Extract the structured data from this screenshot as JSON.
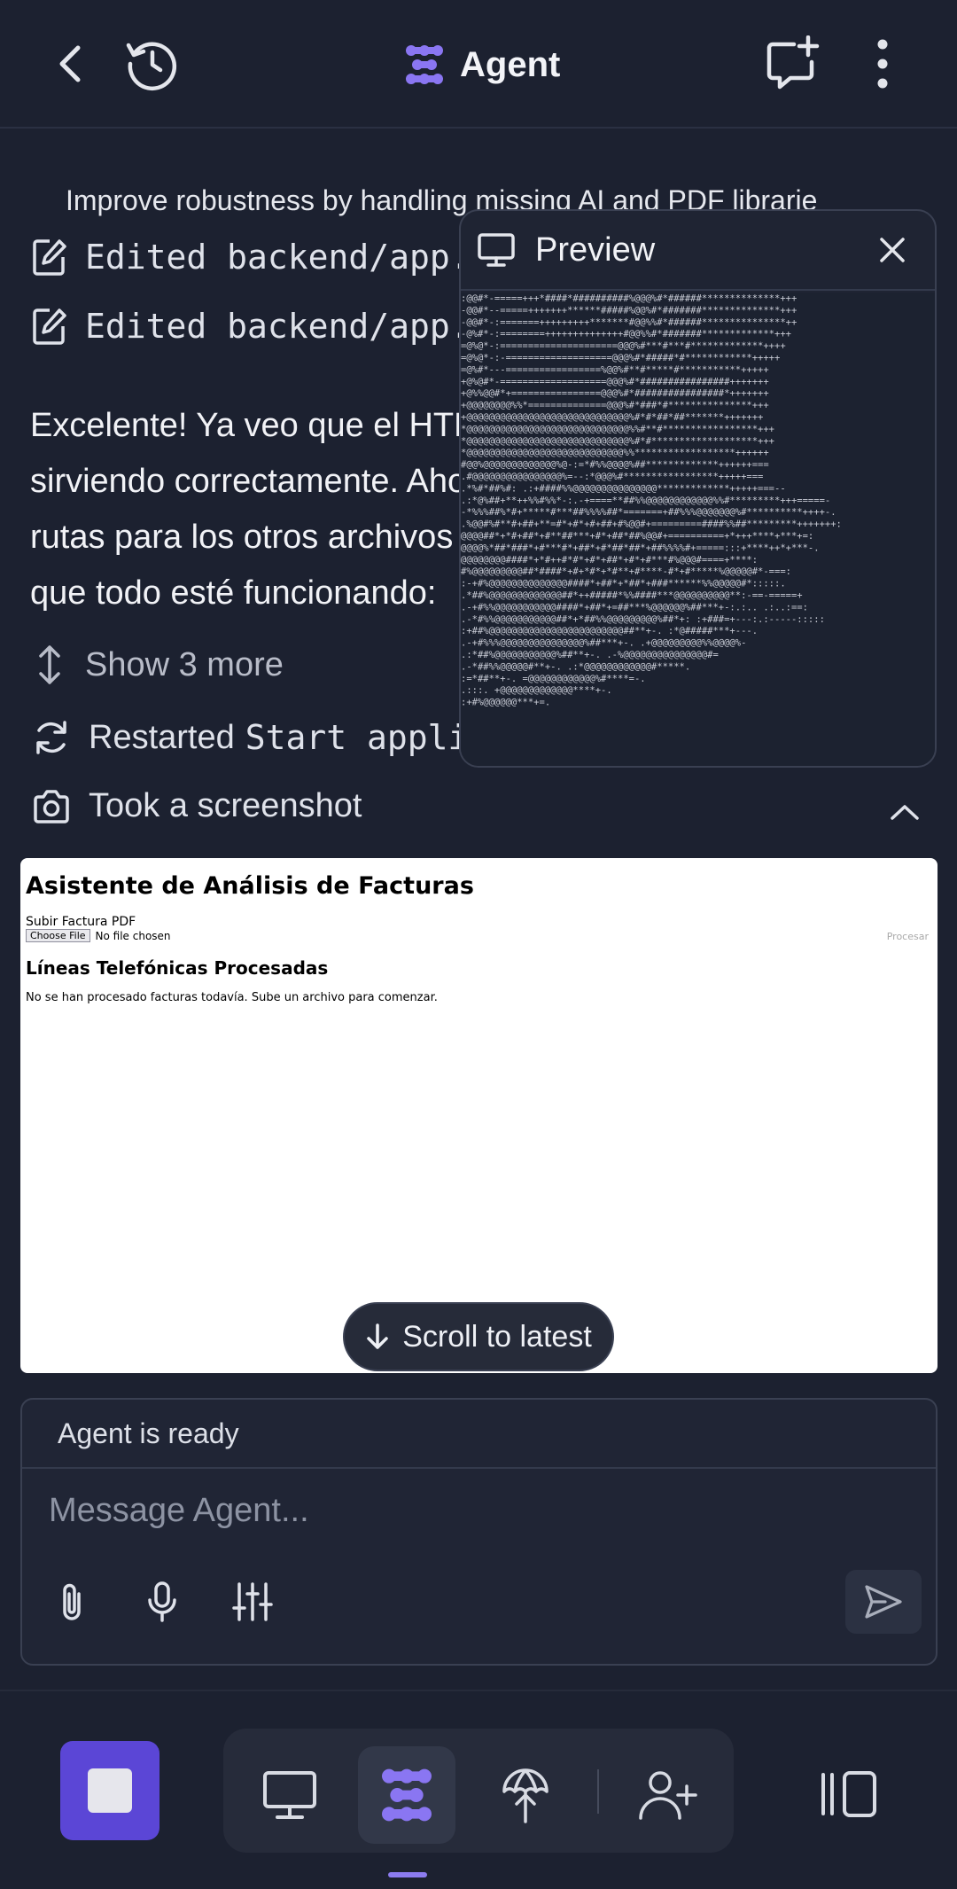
{
  "header": {
    "title": "Agent"
  },
  "chat": {
    "truncated_line": "Improve robustness by handling missing AI and PDF librarie",
    "edits": [
      {
        "label": "Edited backend/app.py"
      },
      {
        "label": "Edited backend/app.py"
      }
    ],
    "message_lines": [
      "Excelente! Ya veo que el HTML se está",
      "sirviendo correctamente. Ahora voy a ajustar las",
      "rutas para los otros archivos estáticos para",
      "que todo esté funcionando:"
    ],
    "show_more": "Show 3 more",
    "restarted_prefix": "Restarted",
    "restarted_code": "Start application",
    "took_screenshot": "Took a screenshot",
    "scroll_to_latest": "Scroll to latest"
  },
  "screenshot": {
    "title": "Asistente de Análisis de Facturas",
    "upload_label": "Subir Factura PDF",
    "choose_file": "Choose File",
    "no_file": "No file chosen",
    "process_button": "Procesar",
    "section_title": "Líneas Telefónicas Procesadas",
    "empty_message": "No se han procesado facturas todavía. Sube un archivo para comenzar."
  },
  "preview": {
    "title": "Preview",
    "ascii_lines": [
      "                     :@@#*-=====+++*####*##########%@@@%#*######**************+++",
      "                     -@@#*--=====+++++++******#####%@@%#*#######**************+++",
      "                     -@@#*-:=======+++++++++*******#@@%%#*######***************++",
      "                     -@%#*-:========++++++++++++++#@@%%#*#######*************+++",
      "                     =@%@*-:=====================@@@%#***#***#*************++++",
      "                     =@%@*-:-===================@@@%#*#####*#************+++++",
      "                     =@%#*---=================%@@%#**#*****#***********+++++",
      "                     +@%@#*-===================@@@%#*################+++++++",
      "                     +@%%@@#*+================@@@%#*################*+++++++",
      "                     +@@@@@@@@%%*==============@@@%#*###*#***************+++",
      "                     +@@@@@@@@@@@@@@@@@@@@@@@@@@@@@%#*#*##*##*******+++++++",
      "                     *@@@@@@@@@@@@@@@@@@@@@@@@@@@@@%%#**#*****************+++",
      "                     *@@@@@@@@@@@@@@@@@@@@@@@@@@@@@%#*#*******************+++",
      "                     *@@@@@@@@@@@@@@@@@@@@@@@@@@@@%%******************++++++",
      "                     #@@%@@@@@@@@@@@@@%@-:=*#%%@@@@%##*************++++++===",
      "                     .#@@@@@@@@@@@@@@@@%=--:*@@@%#*****************+++++===",
      "           .*%#*##%#:    .:+####%%@@@@@@@@@@@@@@@*************+++++===--",
      "       .:*@%##+**++%%#%%*-:.-+====**##%%@@@@@@@@@@@@%%#*********+++=====-",
      "     -*%%%##%*#+*****#***##%%%%##*=======+##%%%@@@@@@@%#**********++++-.",
      "  .%@@#%#**#+##+**=#*+#*+#+##+#%@@#+=========####%%##*********+++++++:",
      " @@@@##*+*#+##*+#**##***+#*+##*##%@@#+==========+*+++****+***+=:",
      " @@@@%*##*###*+#***#*+##*+#*##*##*+##%%%%#+=====:::+****++*+***-.",
      " @@@@@@@@####*+*#++#*#*+#*+##*+#*+#***#%@@@#====+****:",
      " #%@@@@@@@@@##*####*+#+*#*+*#**+#****-#*+#*****%@@@@@#*-===:",
      " :-+#%@@@@@@@@@@@@@@####*+##*+*##*+###******%%@@@@@#*:::::.",
      "      .*##%@@@@@@@@@@@@@##*++#####*%%####***@@@@@@@@@@**:-==-=====+",
      "        .-+#%%@@@@@@@@@@@####*+##*+=##***%@@@@@@%##***+-:.:.. .:..:==:",
      "           .-*#%%@@@@@@@@@@@##*+*##%%@@@@@@@@@%##*+:  :+###=+---:.:-----:::::",
      "              :+##%@@@@@@@@@@@@@@@@@@@@@@@@##**+-.  :*@#####***+---.",
      "                 .-+#%%%@@@@@@@@@@@@@@@%##***+-. .+@@@@@@@@@%%@@@@%-",
      "                    .:*##%@@@@@@@@@@@%##**+-. .-%@@@@@@@@@@@@@@@#=",
      "                        .-*##%%@@@@@#**+-. .:*@@@@@@@@@@@@#*****.",
      "                           :=*##**+-.    =@@@@@@@@@@@@%#****=-.",
      "                              .:::.     +@@@@@@@@@@@@@****+-.",
      "                                         :+#%@@@@@@***+=."
    ]
  },
  "composer": {
    "status": "Agent is ready",
    "placeholder": "Message Agent..."
  },
  "colors": {
    "background": "#1c2130",
    "accent": "#7b66ee",
    "stop_button": "#5b46d6",
    "screenshot_bg": "#ffffff"
  },
  "icons": {
    "back": "chevron-left-icon",
    "history": "history-icon",
    "agent": "agent-logo-icon",
    "new_chat": "new-chat-icon",
    "more": "kebab-menu-icon",
    "edit": "edit-file-icon",
    "expand": "expand-vertical-icon",
    "restart": "refresh-icon",
    "camera": "camera-icon",
    "collapse": "chevron-up-icon",
    "scroll": "arrow-down-icon",
    "preview": "monitor-icon",
    "close": "close-icon",
    "attach": "paperclip-icon",
    "mic": "microphone-icon",
    "settings": "sliders-icon",
    "send": "send-icon",
    "stop": "stop-icon",
    "desktop": "desktop-icon",
    "agent_tab": "agent-tab-icon",
    "deploy": "deploy-icon",
    "invite": "add-user-icon",
    "layout": "layout-icon"
  }
}
